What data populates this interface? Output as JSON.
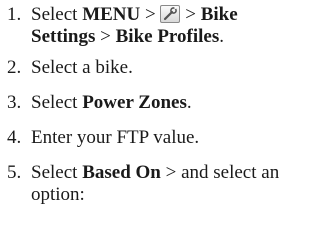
{
  "steps": [
    {
      "number": "1.",
      "parts": {
        "a": "Select ",
        "b": "MENU",
        "c": " > ",
        "icon": "wrench-icon",
        "d": " > ",
        "e": "Bike",
        "f": "Settings",
        "g": " > ",
        "h": "Bike Profiles",
        "i": "."
      }
    },
    {
      "number": "2.",
      "text": "Select a bike."
    },
    {
      "number": "3.",
      "parts": {
        "a": "Select ",
        "b": "Power Zones",
        "c": "."
      }
    },
    {
      "number": "4.",
      "text": "Enter your FTP value."
    },
    {
      "number": "5.",
      "parts": {
        "a": "Select ",
        "b": "Based On",
        "c": " > and select an",
        "d": "option:"
      }
    }
  ]
}
